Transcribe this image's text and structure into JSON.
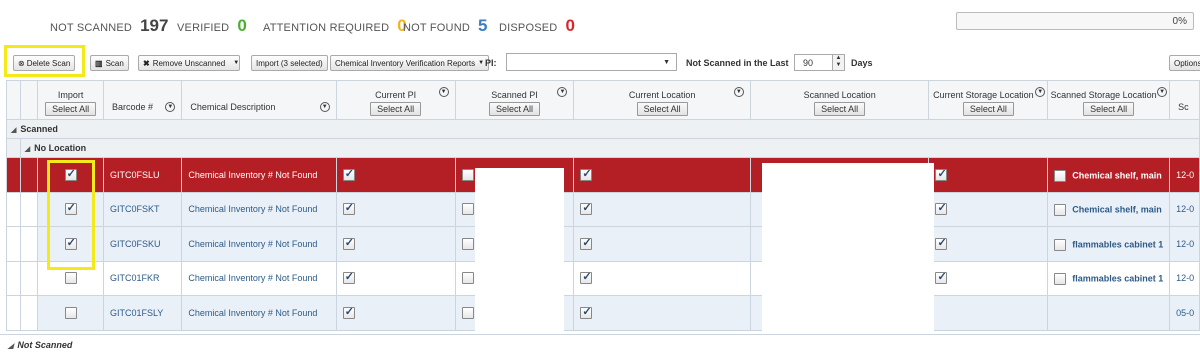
{
  "stats": [
    {
      "label": "NOT SCANNED",
      "value": "197",
      "color": "#444444"
    },
    {
      "label": "VERIFIED",
      "value": "0",
      "color": "#4caf33"
    },
    {
      "label": "ATTENTION REQUIRED",
      "value": "0",
      "color": "#f0b419"
    },
    {
      "label": "NOT FOUND",
      "value": "5",
      "color": "#3a7fc2"
    },
    {
      "label": "DISPOSED",
      "value": "0",
      "color": "#d6282a"
    }
  ],
  "progress": {
    "text": "0%",
    "fraction": 0
  },
  "toolbar": {
    "delete_scan": "Delete Scan",
    "scan": "Scan",
    "remove_unscanned": "Remove Unscanned",
    "import_selected": "Import (3 selected)",
    "reports": "Chemical Inventory Verification Reports",
    "pi_label": "PI:",
    "pi_value": "",
    "not_scanned_label": "Not Scanned in the Last",
    "days_value": "90",
    "days_label": "Days",
    "options": "Options"
  },
  "columns": {
    "import": "Import",
    "barcode": "Barcode #",
    "description": "Chemical Description",
    "current_pi": "Current PI",
    "scanned_pi": "Scanned PI",
    "current_location": "Current Location",
    "scanned_location": "Scanned Location",
    "current_storage": "Current Storage Location",
    "scanned_storage": "Scanned Storage Location",
    "sc": "Sc",
    "select_all": "Select All"
  },
  "groups": {
    "scanned": "Scanned",
    "no_location": "No Location",
    "not_scanned": "Not Scanned"
  },
  "rows": [
    {
      "barcode": "GITC0FSLU",
      "description": "Chemical Inventory # Not Found",
      "import": true,
      "current_pi": true,
      "current_location": true,
      "current_storage": true,
      "storage": "Chemical shelf, main",
      "date": "12-0"
    },
    {
      "barcode": "GITC0FSKT",
      "description": "Chemical Inventory # Not Found",
      "import": true,
      "current_pi": true,
      "current_location": true,
      "current_storage": true,
      "storage": "Chemical shelf, main",
      "date": "12-0"
    },
    {
      "barcode": "GITC0FSKU",
      "description": "Chemical Inventory # Not Found",
      "import": true,
      "current_pi": true,
      "current_location": true,
      "current_storage": true,
      "storage": "flammables cabinet 1",
      "date": "12-0"
    },
    {
      "barcode": "GITC01FKR",
      "description": "Chemical Inventory # Not Found",
      "import": false,
      "current_pi": true,
      "current_location": true,
      "current_storage": true,
      "storage": "flammables cabinet 1",
      "date": "12-0"
    },
    {
      "barcode": "GITC01FSLY",
      "description": "Chemical Inventory # Not Found",
      "import": false,
      "current_pi": true,
      "current_location": true,
      "current_storage": false,
      "storage": "",
      "date": "05-0"
    }
  ],
  "highlight_color": "#f4ea1a",
  "selected_row_color": "#b41e25"
}
